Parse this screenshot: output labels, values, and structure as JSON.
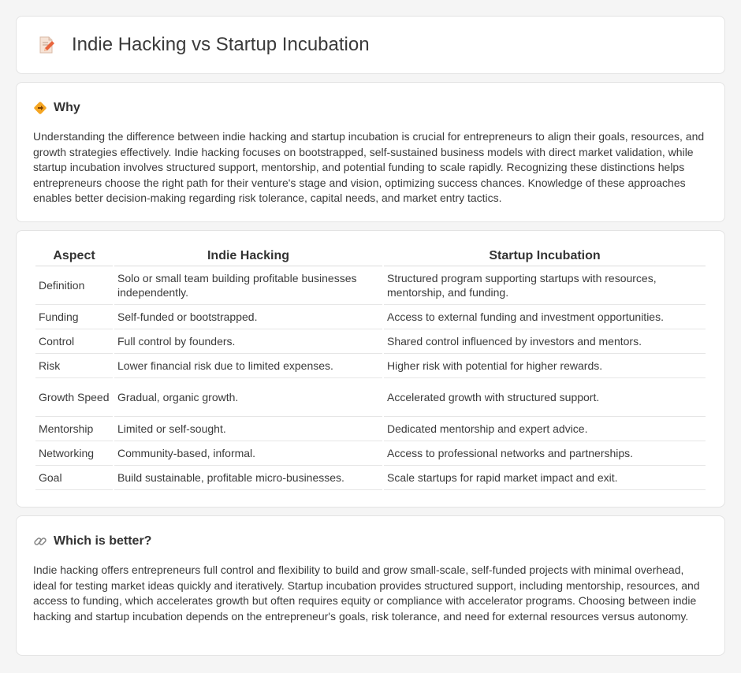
{
  "header": {
    "title": "Indie Hacking vs Startup Incubation",
    "icon": "document-pencil-icon"
  },
  "why": {
    "title": "Why",
    "icon": "diamond-arrow-icon",
    "text": "Understanding the difference between indie hacking and startup incubation is crucial for entrepreneurs to align their goals, resources, and growth strategies effectively. Indie hacking focuses on bootstrapped, self-sustained business models with direct market validation, while startup incubation involves structured support, mentorship, and potential funding to scale rapidly. Recognizing these distinctions helps entrepreneurs choose the right path for their venture's stage and vision, optimizing success chances. Knowledge of these approaches enables better decision-making regarding risk tolerance, capital needs, and market entry tactics."
  },
  "table": {
    "headers": [
      "Aspect",
      "Indie Hacking",
      "Startup Incubation"
    ],
    "rows": [
      [
        "Definition",
        "Solo or small team building profitable businesses independently.",
        "Structured program supporting startups with resources, mentorship, and funding."
      ],
      [
        "Funding",
        "Self-funded or bootstrapped.",
        "Access to external funding and investment opportunities."
      ],
      [
        "Control",
        "Full control by founders.",
        "Shared control influenced by investors and mentors."
      ],
      [
        "Risk",
        "Lower financial risk due to limited expenses.",
        "Higher risk with potential for higher rewards."
      ],
      [
        "Growth Speed",
        "Gradual, organic growth.",
        "Accelerated growth with structured support."
      ],
      [
        "Mentorship",
        "Limited or self-sought.",
        "Dedicated mentorship and expert advice."
      ],
      [
        "Networking",
        "Community-based, informal.",
        "Access to professional networks and partnerships."
      ],
      [
        "Goal",
        "Build sustainable, profitable micro-businesses.",
        "Scale startups for rapid market impact and exit."
      ]
    ]
  },
  "better": {
    "title": "Which is better?",
    "icon": "link-icon",
    "text": "Indie hacking offers entrepreneurs full control and flexibility to build and grow small-scale, self-funded projects with minimal overhead, ideal for testing market ideas quickly and iteratively. Startup incubation provides structured support, including mentorship, resources, and access to funding, which accelerates growth but often requires equity or compliance with accelerator programs. Choosing between indie hacking and startup incubation depends on the entrepreneur's goals, risk tolerance, and need for external resources versus autonomy."
  }
}
